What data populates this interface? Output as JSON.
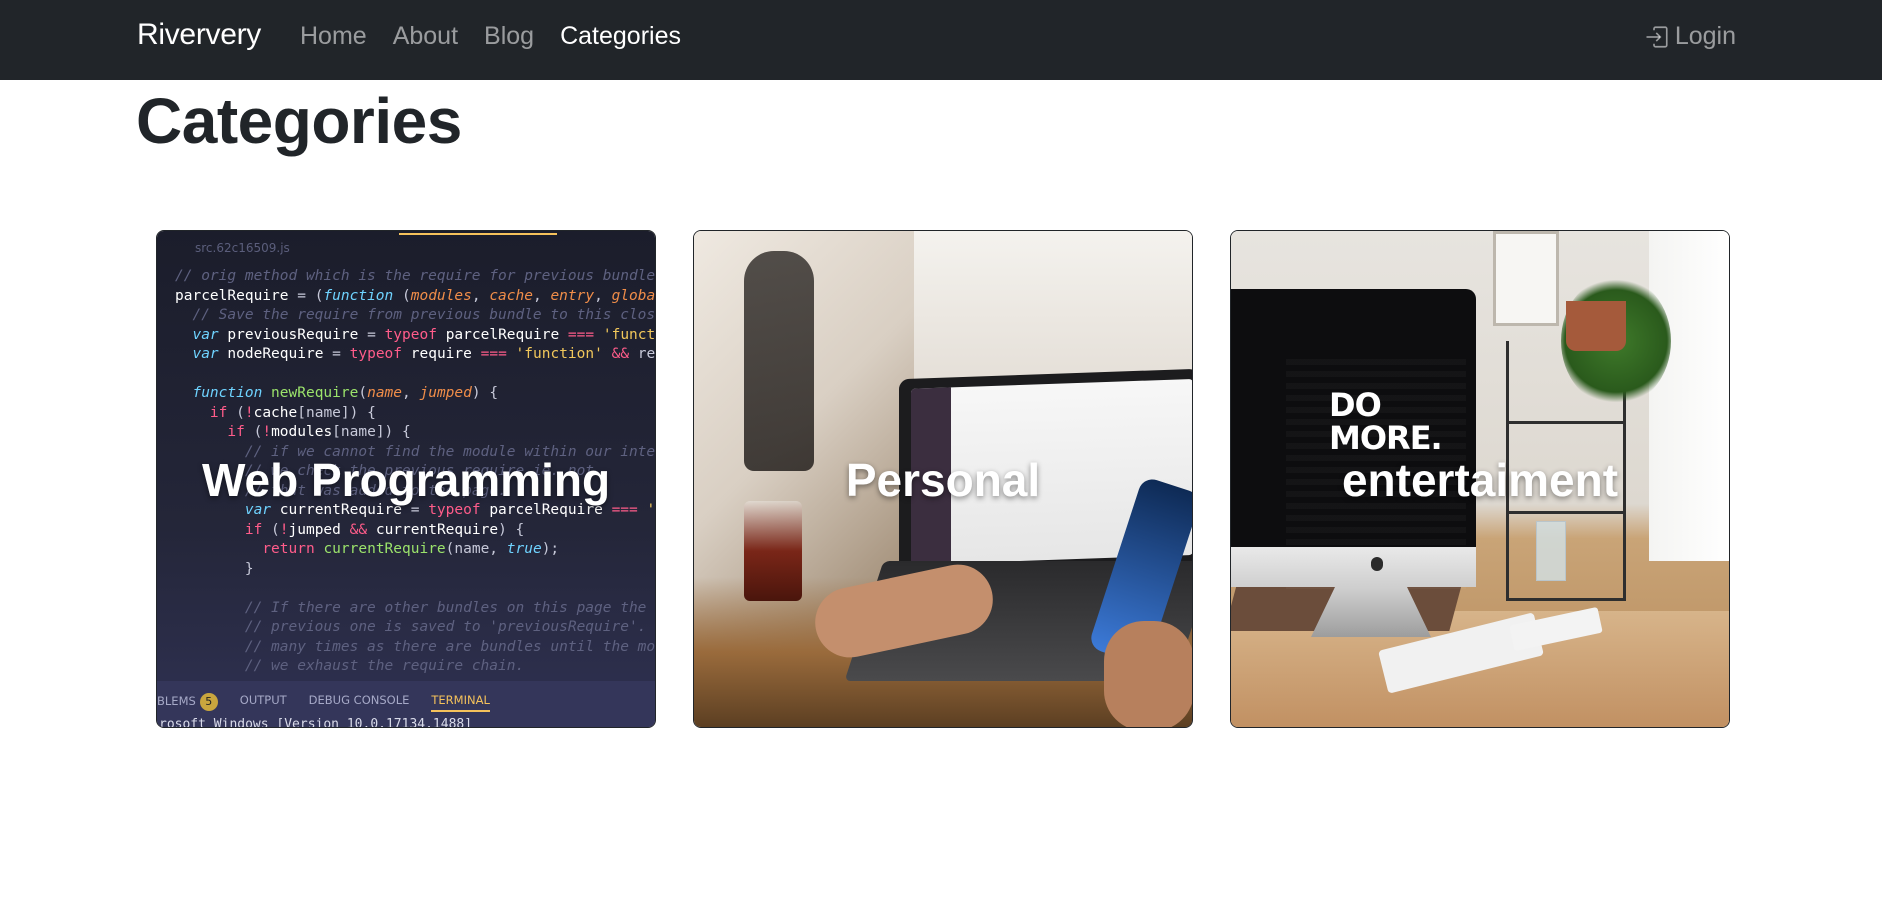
{
  "navbar": {
    "brand": "Riververy",
    "links": [
      {
        "label": "Home",
        "active": false
      },
      {
        "label": "About",
        "active": false
      },
      {
        "label": "Blog",
        "active": false
      },
      {
        "label": "Categories",
        "active": true
      }
    ],
    "login_label": "Login",
    "login_icon": "box-arrow-in-right-icon",
    "bg_color": "#212529"
  },
  "page": {
    "title": "Categories"
  },
  "categories": [
    {
      "label": "Web Programming",
      "image": "code-editor-photo"
    },
    {
      "label": "Personal",
      "image": "laptop-and-phone-photo"
    },
    {
      "label": "entertaiment",
      "image": "desk-setup-photo"
    }
  ],
  "card1_image_text": {
    "tab": "src.62c16509.js",
    "terminal_tabs": [
      "BLEMS",
      "OUTPUT",
      "DEBUG CONSOLE",
      "TERMINAL"
    ],
    "terminal_badge": "5",
    "terminal_line": "rosoft Windows [Version 10.0.17134.1488]"
  },
  "card3_image_text": {
    "monitor_text_line1": "DO",
    "monitor_text_line2": "MORE."
  }
}
